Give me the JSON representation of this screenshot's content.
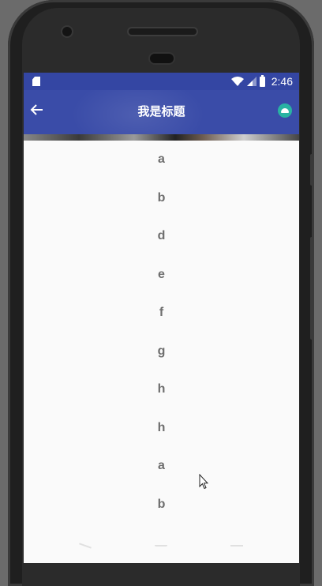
{
  "status_bar": {
    "time": "2:46"
  },
  "app_bar": {
    "title": "我是标题"
  },
  "list": {
    "items": [
      "a",
      "b",
      "d",
      "e",
      "f",
      "g",
      "h",
      "h",
      "a",
      "b"
    ]
  },
  "colors": {
    "primary": "#3a4ca8",
    "status_bar": "#3446a3",
    "fab_accent": "#29b3a3",
    "list_text": "#6e6e6e"
  },
  "icons": {
    "back": "arrow-left-icon",
    "action": "android-icon",
    "status": [
      "sd-card-icon",
      "wifi-icon",
      "signal-icon",
      "battery-icon"
    ]
  }
}
